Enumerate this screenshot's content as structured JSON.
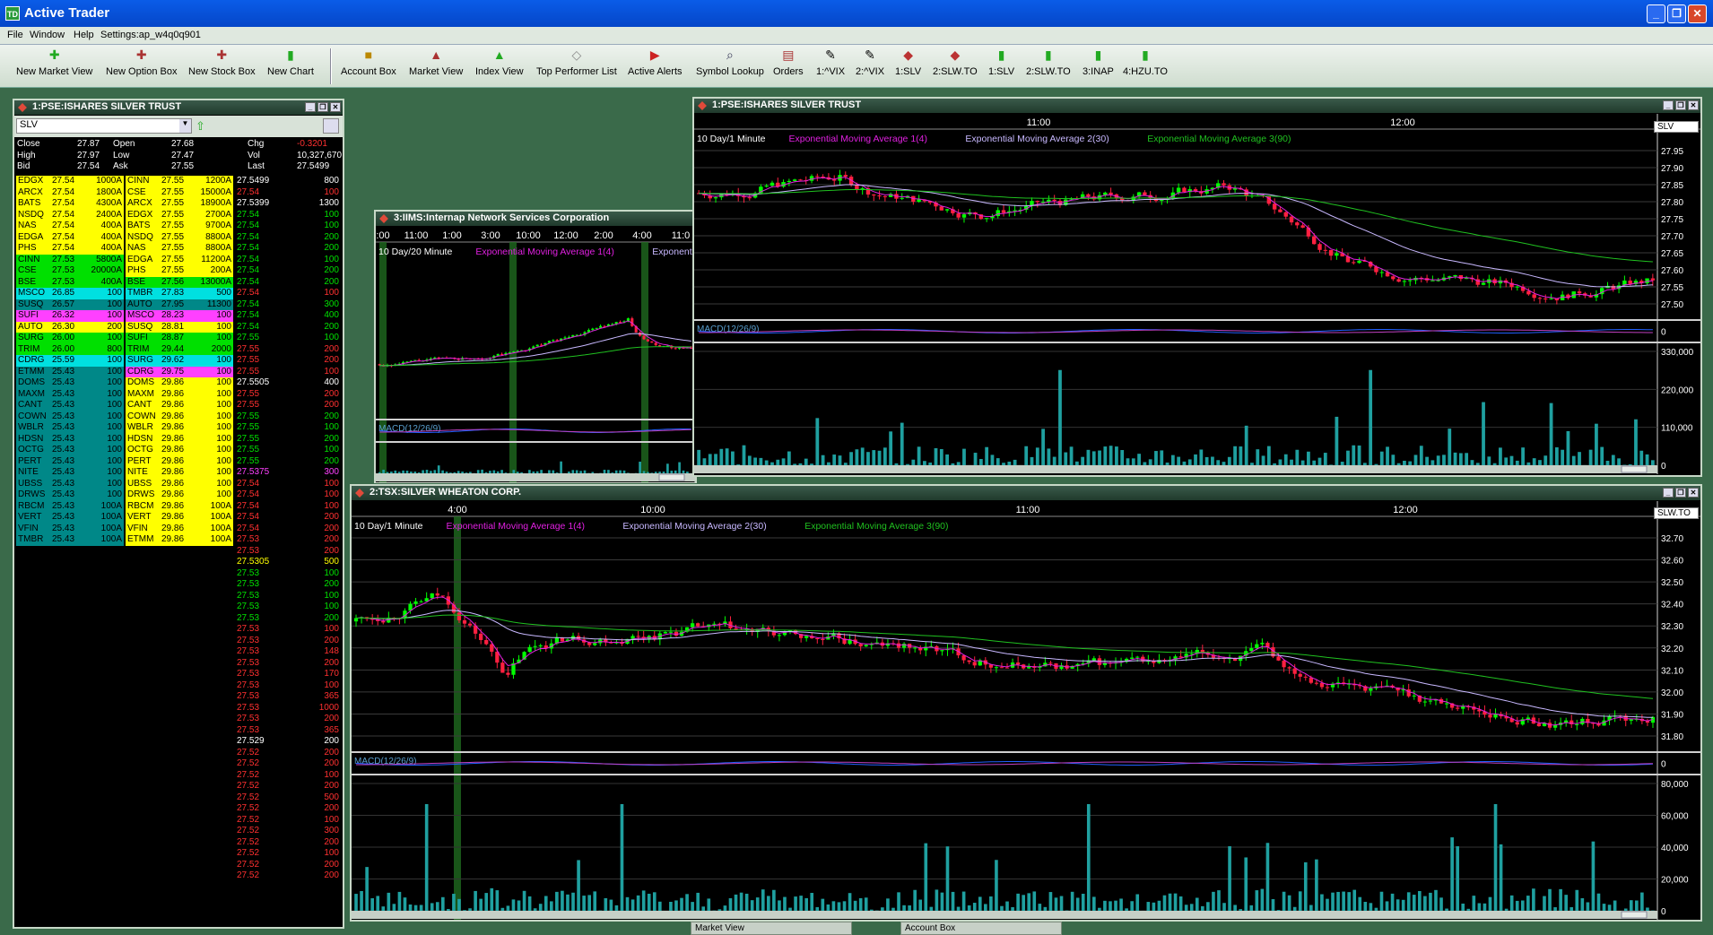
{
  "app": {
    "title": "Active Trader",
    "min": "_",
    "max": "❐",
    "close": "✕"
  },
  "menu": [
    "File",
    "Window",
    "Help",
    "Settings:ap_w4q0q901"
  ],
  "toolbar": [
    "New Market View",
    "New Option Box",
    "New Stock Box",
    "New Chart",
    "Account Box",
    "Market View",
    "Index View",
    "Top Performer List",
    "Active Alerts",
    "Symbol Lookup",
    "Orders",
    "1:^VIX",
    "2:^VIX",
    "1:SLV",
    "2:SLW.TO",
    "1:SLV",
    "2:SLW.TO",
    "3:INAP",
    "4:HZU.TO"
  ],
  "colors": {
    "green": "#00e000",
    "yellow": "#ffff00",
    "cyan": "#00e0e0",
    "magenta": "#ff40ff",
    "teal": "#008888",
    "red": "#ff3030",
    "bg": "#000000"
  },
  "quote": {
    "title": "1:PSE:ISHARES SILVER TRUST",
    "symbol": "SLV",
    "summary": [
      [
        "Close",
        "27.87",
        "Open",
        "27.68",
        "Chg",
        "-0.3201"
      ],
      [
        "High",
        "27.97",
        "Low",
        "27.47",
        "Vol",
        "10,327,670"
      ],
      [
        "Bid",
        "27.54",
        "Ask",
        "27.55",
        "Last",
        "27.5499"
      ]
    ],
    "bids": [
      [
        "EDGX",
        "27.54",
        "1000A",
        "y"
      ],
      [
        "ARCX",
        "27.54",
        "1800A",
        "y"
      ],
      [
        "BATS",
        "27.54",
        "4300A",
        "y"
      ],
      [
        "NSDQ",
        "27.54",
        "2400A",
        "y"
      ],
      [
        "NAS",
        "27.54",
        "400A",
        "y"
      ],
      [
        "EDGA",
        "27.54",
        "400A",
        "y"
      ],
      [
        "PHS",
        "27.54",
        "400A",
        "y"
      ],
      [
        "CINN",
        "27.53",
        "5800A",
        "g"
      ],
      [
        "CSE",
        "27.53",
        "20000A",
        "g"
      ],
      [
        "BSE",
        "27.53",
        "400A",
        "g"
      ],
      [
        "MSCO",
        "26.85",
        "100",
        "c"
      ],
      [
        "SUSQ",
        "26.57",
        "100",
        "t"
      ],
      [
        "SUFI",
        "26.32",
        "100",
        "m"
      ],
      [
        "AUTO",
        "26.30",
        "200",
        "y"
      ],
      [
        "SURG",
        "26.00",
        "100",
        "g"
      ],
      [
        "TRIM",
        "26.00",
        "800",
        "g"
      ],
      [
        "CDRG",
        "25.59",
        "100",
        "c"
      ],
      [
        "ETMM",
        "25.43",
        "100",
        "t"
      ],
      [
        "DOMS",
        "25.43",
        "100",
        "t"
      ],
      [
        "MAXM",
        "25.43",
        "100",
        "t"
      ],
      [
        "CANT",
        "25.43",
        "100",
        "t"
      ],
      [
        "COWN",
        "25.43",
        "100",
        "t"
      ],
      [
        "WBLR",
        "25.43",
        "100",
        "t"
      ],
      [
        "HDSN",
        "25.43",
        "100",
        "t"
      ],
      [
        "OCTG",
        "25.43",
        "100",
        "t"
      ],
      [
        "PERT",
        "25.43",
        "100",
        "t"
      ],
      [
        "NITE",
        "25.43",
        "100",
        "t"
      ],
      [
        "UBSS",
        "25.43",
        "100",
        "t"
      ],
      [
        "DRWS",
        "25.43",
        "100",
        "t"
      ],
      [
        "RBCM",
        "25.43",
        "100A",
        "t"
      ],
      [
        "VERT",
        "25.43",
        "100A",
        "t"
      ],
      [
        "VFIN",
        "25.43",
        "100A",
        "t"
      ],
      [
        "TMBR",
        "25.43",
        "100A",
        "t"
      ]
    ],
    "asks": [
      [
        "CINN",
        "27.55",
        "1200A",
        "y"
      ],
      [
        "CSE",
        "27.55",
        "15000A",
        "y"
      ],
      [
        "ARCX",
        "27.55",
        "18900A",
        "y"
      ],
      [
        "EDGX",
        "27.55",
        "2700A",
        "y"
      ],
      [
        "BATS",
        "27.55",
        "9700A",
        "y"
      ],
      [
        "NSDQ",
        "27.55",
        "8800A",
        "y"
      ],
      [
        "NAS",
        "27.55",
        "8800A",
        "y"
      ],
      [
        "EDGA",
        "27.55",
        "11200A",
        "y"
      ],
      [
        "PHS",
        "27.55",
        "200A",
        "y"
      ],
      [
        "BSE",
        "27.56",
        "13000A",
        "g"
      ],
      [
        "TMBR",
        "27.83",
        "500",
        "c"
      ],
      [
        "AUTO",
        "27.95",
        "11300",
        "t"
      ],
      [
        "MSCO",
        "28.23",
        "100",
        "m"
      ],
      [
        "SUSQ",
        "28.81",
        "100",
        "y"
      ],
      [
        "SUFI",
        "28.87",
        "100",
        "g"
      ],
      [
        "TRIM",
        "29.44",
        "2000",
        "g"
      ],
      [
        "SURG",
        "29.62",
        "100",
        "c"
      ],
      [
        "CDRG",
        "29.75",
        "100",
        "m"
      ],
      [
        "DOMS",
        "29.86",
        "100",
        "y"
      ],
      [
        "MAXM",
        "29.86",
        "100",
        "y"
      ],
      [
        "CANT",
        "29.86",
        "100",
        "y"
      ],
      [
        "COWN",
        "29.86",
        "100",
        "y"
      ],
      [
        "WBLR",
        "29.86",
        "100",
        "y"
      ],
      [
        "HDSN",
        "29.86",
        "100",
        "y"
      ],
      [
        "OCTG",
        "29.86",
        "100",
        "y"
      ],
      [
        "PERT",
        "29.86",
        "100",
        "y"
      ],
      [
        "NITE",
        "29.86",
        "100",
        "y"
      ],
      [
        "UBSS",
        "29.86",
        "100",
        "y"
      ],
      [
        "DRWS",
        "29.86",
        "100",
        "y"
      ],
      [
        "RBCM",
        "29.86",
        "100A",
        "y"
      ],
      [
        "VERT",
        "29.86",
        "100A",
        "y"
      ],
      [
        "VFIN",
        "29.86",
        "100A",
        "y"
      ],
      [
        "ETMM",
        "29.86",
        "100A",
        "y"
      ]
    ],
    "trades": [
      [
        "27.5499",
        "800",
        "w"
      ],
      [
        "27.54",
        "100",
        "r"
      ],
      [
        "27.5399",
        "1300",
        "w"
      ],
      [
        "27.54",
        "100",
        "g"
      ],
      [
        "27.54",
        "100",
        "g"
      ],
      [
        "27.54",
        "200",
        "g"
      ],
      [
        "27.54",
        "200",
        "g"
      ],
      [
        "27.54",
        "100",
        "g"
      ],
      [
        "27.54",
        "200",
        "g"
      ],
      [
        "27.54",
        "200",
        "g"
      ],
      [
        "27.54",
        "100",
        "r"
      ],
      [
        "27.54",
        "300",
        "g"
      ],
      [
        "27.54",
        "400",
        "g"
      ],
      [
        "27.54",
        "200",
        "g"
      ],
      [
        "27.55",
        "100",
        "g"
      ],
      [
        "27.55",
        "200",
        "r"
      ],
      [
        "27.55",
        "200",
        "r"
      ],
      [
        "27.55",
        "100",
        "r"
      ],
      [
        "27.5505",
        "400",
        "w"
      ],
      [
        "27.55",
        "200",
        "r"
      ],
      [
        "27.55",
        "200",
        "r"
      ],
      [
        "27.55",
        "200",
        "g"
      ],
      [
        "27.55",
        "100",
        "g"
      ],
      [
        "27.55",
        "200",
        "g"
      ],
      [
        "27.55",
        "100",
        "g"
      ],
      [
        "27.55",
        "200",
        "g"
      ],
      [
        "27.5375",
        "300",
        "m"
      ],
      [
        "27.54",
        "100",
        "r"
      ],
      [
        "27.54",
        "100",
        "r"
      ],
      [
        "27.54",
        "100",
        "r"
      ],
      [
        "27.54",
        "200",
        "r"
      ],
      [
        "27.54",
        "200",
        "r"
      ],
      [
        "27.53",
        "200",
        "r"
      ],
      [
        "27.53",
        "200",
        "r"
      ],
      [
        "27.5305",
        "500",
        "y"
      ],
      [
        "27.53",
        "100",
        "g"
      ],
      [
        "27.53",
        "200",
        "g"
      ],
      [
        "27.53",
        "100",
        "g"
      ],
      [
        "27.53",
        "100",
        "g"
      ],
      [
        "27.53",
        "200",
        "g"
      ],
      [
        "27.53",
        "100",
        "r"
      ],
      [
        "27.53",
        "200",
        "r"
      ],
      [
        "27.53",
        "148",
        "r"
      ],
      [
        "27.53",
        "200",
        "r"
      ],
      [
        "27.53",
        "170",
        "r"
      ],
      [
        "27.53",
        "100",
        "r"
      ],
      [
        "27.53",
        "365",
        "r"
      ],
      [
        "27.53",
        "1000",
        "r"
      ],
      [
        "27.53",
        "200",
        "r"
      ],
      [
        "27.53",
        "365",
        "r"
      ],
      [
        "27.529",
        "200",
        "w"
      ],
      [
        "27.52",
        "200",
        "r"
      ],
      [
        "27.52",
        "200",
        "r"
      ],
      [
        "27.52",
        "100",
        "r"
      ],
      [
        "27.52",
        "200",
        "r"
      ],
      [
        "27.52",
        "500",
        "r"
      ],
      [
        "27.52",
        "200",
        "r"
      ],
      [
        "27.52",
        "100",
        "r"
      ],
      [
        "27.52",
        "300",
        "r"
      ],
      [
        "27.52",
        "200",
        "r"
      ],
      [
        "27.52",
        "100",
        "r"
      ],
      [
        "27.52",
        "200",
        "r"
      ],
      [
        "27.52",
        "200",
        "r"
      ]
    ]
  },
  "chart1": {
    "title": "1:PSE:ISHARES SILVER TRUST",
    "symbol": "SLV",
    "period": "10 Day/1 Minute",
    "ema1": "Exponential Moving Average 1(4)",
    "ema2": "Exponential Moving Average 2(30)",
    "ema3": "Exponential Moving Average 3(90)",
    "times": [
      "11:00",
      "12:00"
    ],
    "prices": [
      "27.95",
      "27.90",
      "27.85",
      "27.80",
      "27.75",
      "27.70",
      "27.65",
      "27.60",
      "27.55",
      "27.50"
    ],
    "macd": "MACD(12/26/9)",
    "macd_zero": "0",
    "vols": [
      "330,000",
      "220,000",
      "110,000",
      "0"
    ]
  },
  "chart3": {
    "title": "3:IIMS:Internap Network Services Corporation",
    "period": "10 Day/20 Minute",
    "ema1": "Exponential Moving Average 1(4)",
    "ema2": "Exponential M",
    "times": [
      ":00",
      "11:00",
      "1:00",
      "3:00",
      "10:00",
      "12:00",
      "2:00",
      "4:00",
      "11:0"
    ],
    "macd": "MACD(12/26/9)"
  },
  "chart2": {
    "title": "2:TSX:SILVER WHEATON CORP.",
    "symbol": "SLW.TO",
    "period": "10 Day/1 Minute",
    "ema1": "Exponential Moving Average 1(4)",
    "ema2": "Exponential Moving Average 2(30)",
    "ema3": "Exponential Moving Average 3(90)",
    "times": [
      "4:00",
      "10:00",
      "11:00",
      "12:00"
    ],
    "prices": [
      "32.70",
      "32.60",
      "32.50",
      "32.40",
      "32.30",
      "32.20",
      "32.10",
      "32.00",
      "31.90",
      "31.80"
    ],
    "macd": "MACD(12/26/9)",
    "macd_zero": "0",
    "vols": [
      "80,000",
      "60,000",
      "40,000",
      "20,000",
      "0"
    ]
  },
  "taskbar": [
    "Market View",
    "Account Box"
  ]
}
